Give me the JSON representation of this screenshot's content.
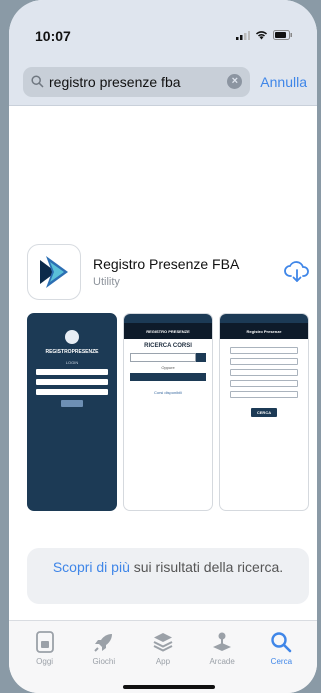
{
  "status_bar": {
    "time": "10:07"
  },
  "search": {
    "query": "registro presenze fba",
    "cancel_label": "Annulla"
  },
  "app": {
    "name": "Registro Presenze FBA",
    "category": "Utility"
  },
  "screenshots": {
    "shot1": {
      "title": "REGISTROPRESENZE",
      "subtitle": "LOGIN"
    },
    "shot2": {
      "bar_title": "REGISTRO PRESENZE",
      "heading": "RICERCA CORSI",
      "small": "Oppure",
      "info": "Corsi disponibili"
    },
    "shot3": {
      "bar_title": "Registro Presenze",
      "button": "CERCA"
    }
  },
  "more_results": {
    "link": "Scopri di più",
    "rest": " sui risultati della ricerca."
  },
  "tabs": [
    {
      "label": "Oggi",
      "icon": "today-icon"
    },
    {
      "label": "Giochi",
      "icon": "rocket-icon"
    },
    {
      "label": "App",
      "icon": "layers-icon"
    },
    {
      "label": "Arcade",
      "icon": "joystick-icon"
    },
    {
      "label": "Cerca",
      "icon": "search-icon"
    }
  ],
  "colors": {
    "accent": "#3f86e8",
    "app_dark": "#1c3a55"
  }
}
